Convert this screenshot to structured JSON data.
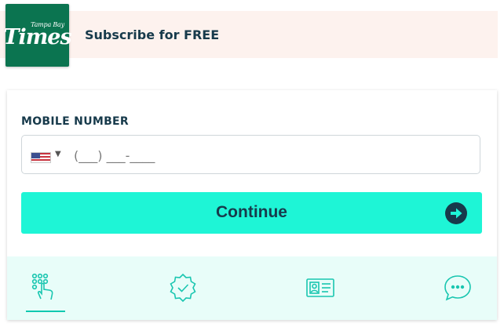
{
  "header": {
    "logo_top": "Tampa Bay",
    "logo_main": "Times",
    "subscribe_text": "Subscribe for FREE"
  },
  "form": {
    "mobile_label": "MOBILE NUMBER",
    "phone_placeholder": "(___) ___-____",
    "country_caret": "▼",
    "continue_label": "Continue"
  },
  "steps": [
    {
      "icon": "keypad-tap-icon",
      "active": true
    },
    {
      "icon": "verified-badge-icon",
      "active": false
    },
    {
      "icon": "id-card-icon",
      "active": false
    },
    {
      "icon": "chat-bubble-icon",
      "active": false
    }
  ],
  "colors": {
    "brand_green": "#0b7450",
    "accent": "#1ef5d6",
    "text_dark": "#173a4b",
    "header_bg": "#fdf2ee",
    "icon_teal": "#19c6b0"
  }
}
